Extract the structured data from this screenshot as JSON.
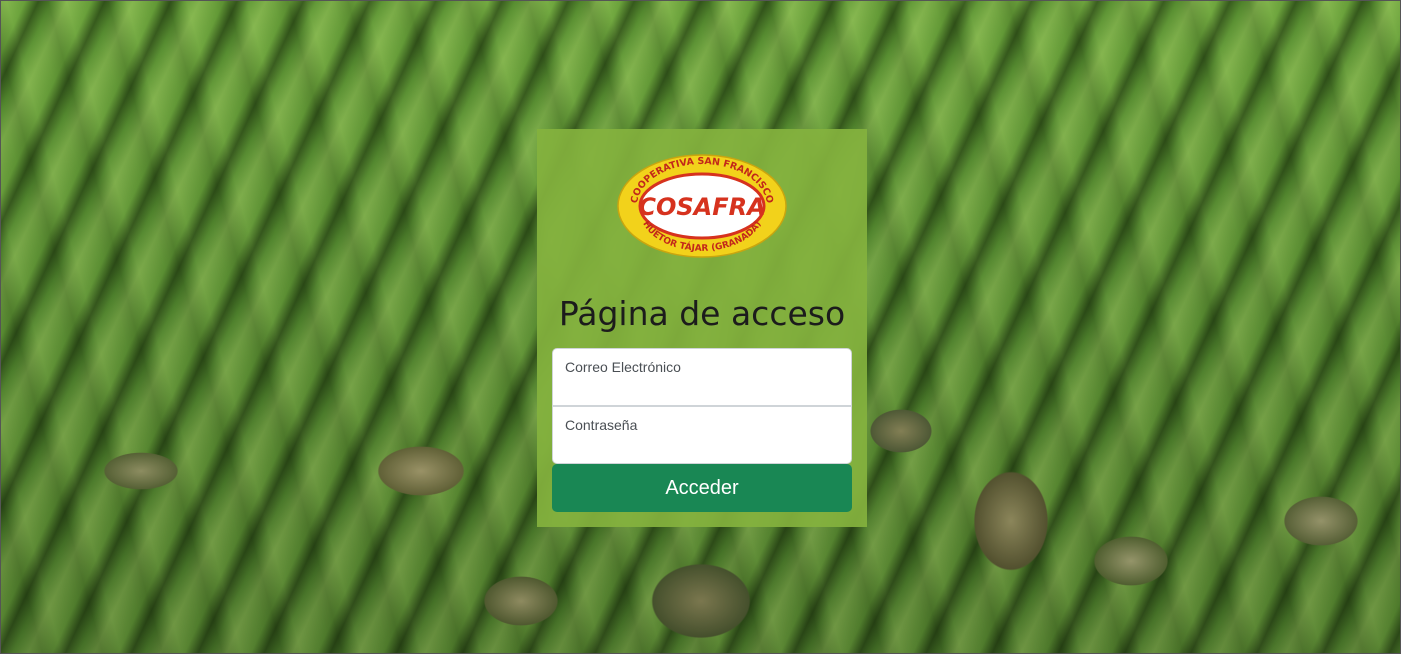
{
  "logo": {
    "top_text": "COOPERATIVA SAN FRANCISCO",
    "brand": "COSAFRA",
    "bottom_text": "HUÉTOR TÁJAR (GRANADA)"
  },
  "login": {
    "title": "Página de acceso",
    "email_label": "Correo Electrónico",
    "email_value": "",
    "password_label": "Contraseña",
    "password_value": "",
    "submit_label": "Acceder"
  },
  "colors": {
    "card": "#84b23e",
    "button": "#198754",
    "logo_yellow": "#f2d21b",
    "logo_red": "#d6321e"
  }
}
